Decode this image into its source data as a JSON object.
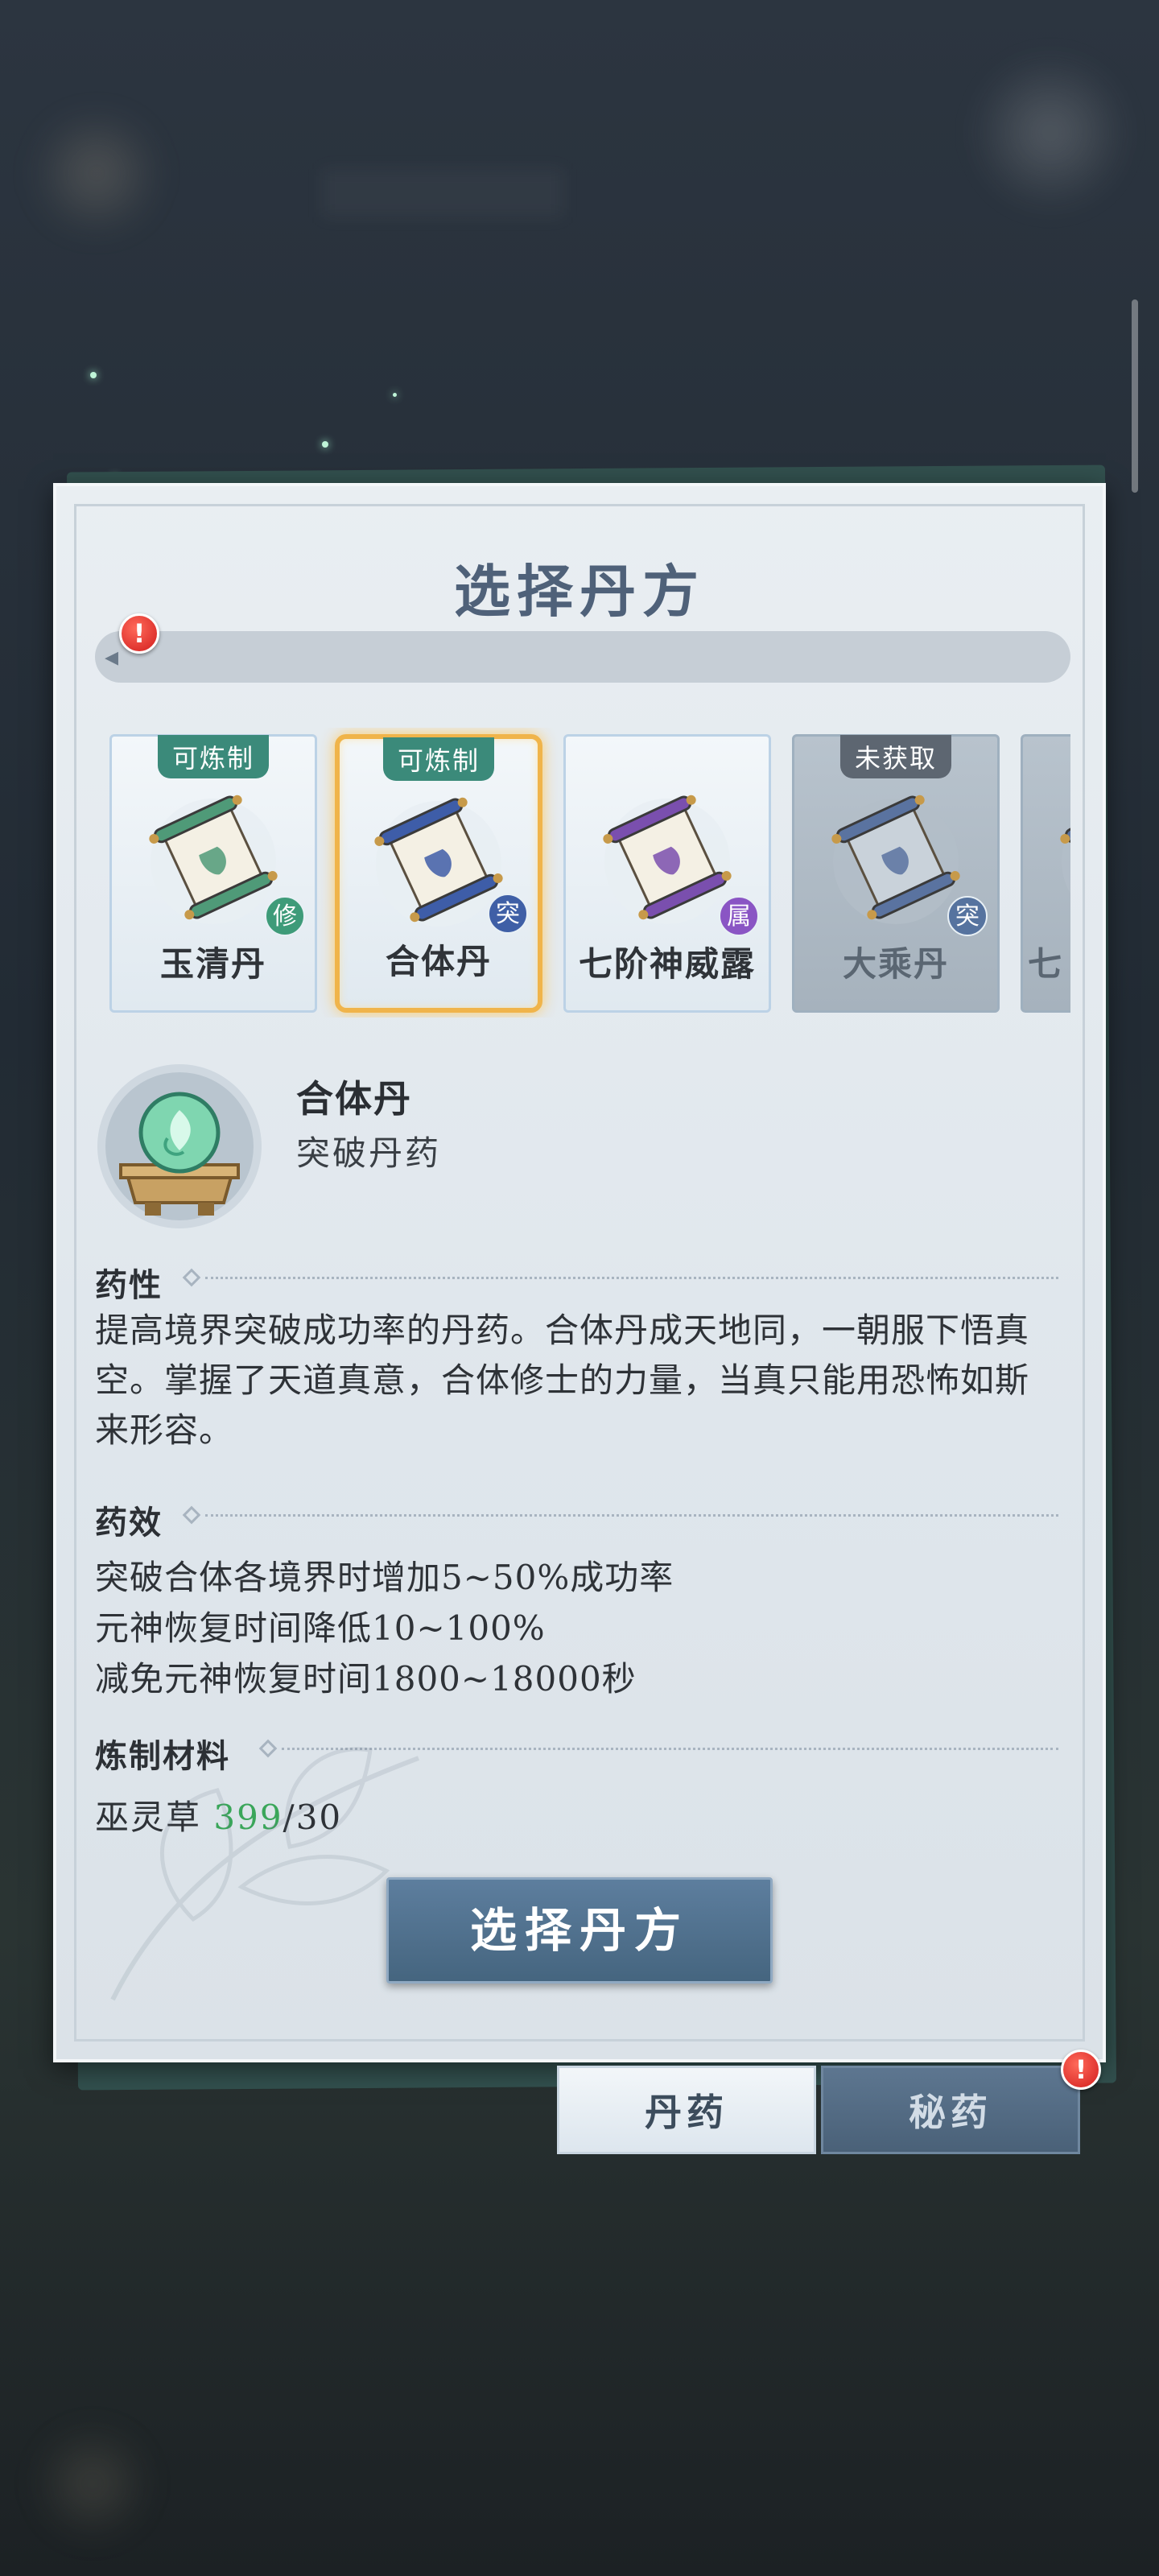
{
  "dialog": {
    "title": "选择丹方",
    "select_button": "选择丹方"
  },
  "search": {
    "placeholder": ""
  },
  "recipes": [
    {
      "status": "可炼制",
      "name": "玉清丹",
      "type_badge": "修",
      "badge_color": "#3e9b79",
      "scroll_color": "#4f9a78",
      "locked": false,
      "selected": false
    },
    {
      "status": "可炼制",
      "name": "合体丹",
      "type_badge": "突",
      "badge_color": "#3f5fa6",
      "scroll_color": "#3e5da8",
      "locked": false,
      "selected": true
    },
    {
      "status": "",
      "name": "七阶神威露",
      "type_badge": "属",
      "badge_color": "#8a55c4",
      "scroll_color": "#7a4fae",
      "locked": false,
      "selected": false
    },
    {
      "status": "未获取",
      "name": "大乘丹",
      "type_badge": "突",
      "badge_color": "#56739f",
      "scroll_color": "#5a73a0",
      "locked": true,
      "selected": false
    },
    {
      "status": "",
      "name": "七",
      "type_badge": "",
      "badge_color": "#56739f",
      "scroll_color": "#5a73a0",
      "locked": true,
      "selected": false
    }
  ],
  "detail": {
    "name": "合体丹",
    "type": "突破丹药",
    "property_heading": "药性",
    "property_text": "提高境界突破成功率的丹药。合体丹成天地同，一朝服下悟真空。掌握了天道真意，合体修士的力量，当真只能用恐怖如斯来形容。",
    "effect_heading": "药效",
    "effects": [
      "突破合体各境界时增加5~50%成功率",
      "元神恢复时间降低10~100%",
      "减免元神恢复时间1800~18000秒"
    ],
    "materials_heading": "炼制材料",
    "materials": [
      {
        "name": "巫灵草",
        "have": "399",
        "need": "/30"
      }
    ]
  },
  "tabs": [
    {
      "label": "丹药",
      "active": true
    },
    {
      "label": "秘药",
      "active": false,
      "alert": true
    }
  ],
  "icons": {
    "alert": "!",
    "back_arrow": "◂"
  },
  "colors": {
    "accent_blue": "#4f6179",
    "ready_green": "#3b8a7a",
    "have_green": "#3aa65a",
    "selected_gold": "#f0b44a"
  }
}
